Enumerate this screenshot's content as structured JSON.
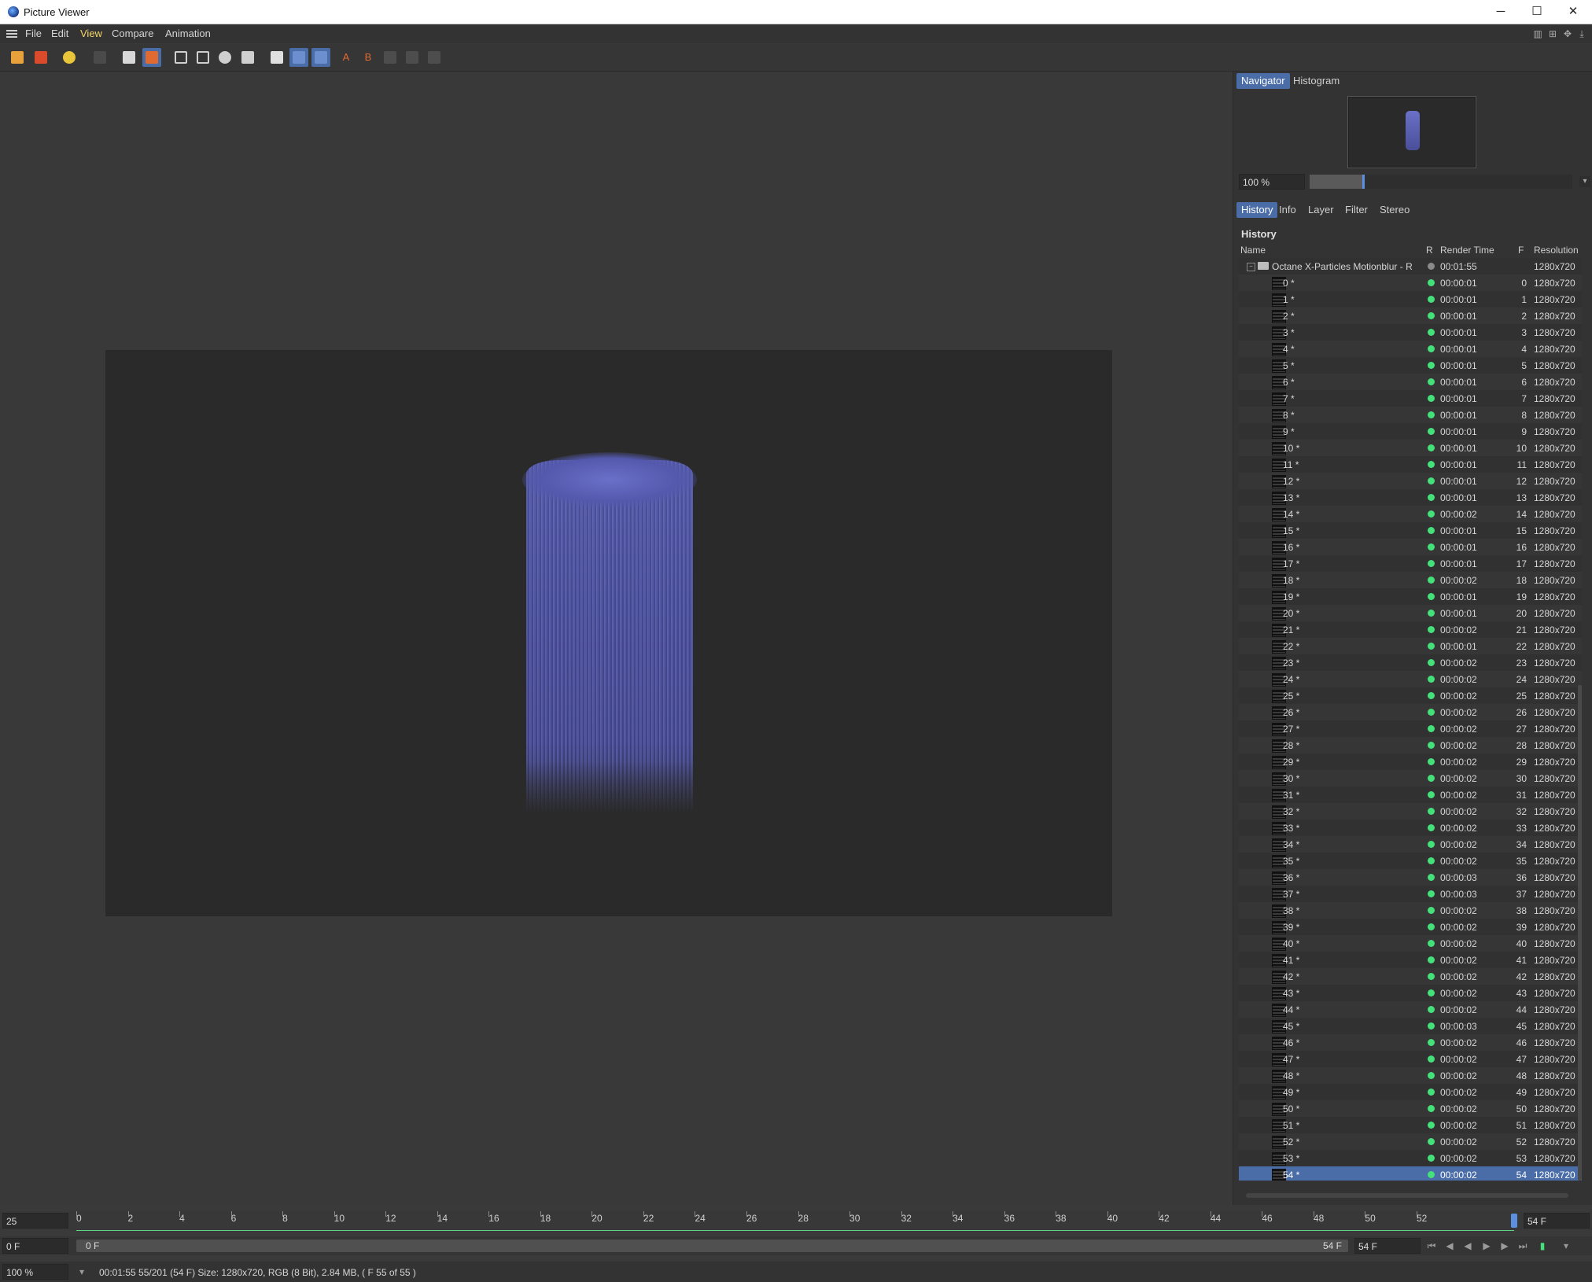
{
  "window": {
    "title": "Picture Viewer",
    "controls": [
      "─",
      "☐",
      "✕"
    ]
  },
  "menu": {
    "items": [
      "File",
      "Edit",
      "View",
      "Compare",
      "Animation"
    ],
    "active": "View"
  },
  "toolbar": {
    "icons": [
      "open-icon",
      "save-icon",
      "render-settings-icon",
      "disabled-icon",
      "export-icon",
      "layer-stack-icon",
      "view-single-icon",
      "view-double-icon",
      "view-overlay-icon",
      "view-edit-icon",
      "split-icon",
      "compare-grid-icon",
      "compare-full-icon",
      "set-a-icon",
      "set-b-icon",
      "swap-icon",
      "diff-icon",
      "wipe-icon"
    ]
  },
  "navigator": {
    "tabs": [
      "Navigator",
      "Histogram"
    ],
    "active_tab": "Navigator",
    "zoom": "100 %",
    "zoom_level_fraction": 0.2
  },
  "panel_tabs": {
    "items": [
      "History",
      "Info",
      "Layer",
      "Filter",
      "Stereo"
    ],
    "active": "History"
  },
  "history": {
    "title": "History",
    "columns": {
      "name": "Name",
      "r": "R",
      "render_time": "Render Time",
      "f": "F",
      "resolution": "Resolution"
    },
    "group": {
      "name": "Octane X-Particles Motionblur - R",
      "render_time": "00:01:55",
      "resolution": "1280x720"
    },
    "rows": [
      {
        "name": "0 *",
        "t": "00:00:01",
        "f": "0"
      },
      {
        "name": "1 *",
        "t": "00:00:01",
        "f": "1"
      },
      {
        "name": "2 *",
        "t": "00:00:01",
        "f": "2"
      },
      {
        "name": "3 *",
        "t": "00:00:01",
        "f": "3"
      },
      {
        "name": "4 *",
        "t": "00:00:01",
        "f": "4"
      },
      {
        "name": "5 *",
        "t": "00:00:01",
        "f": "5"
      },
      {
        "name": "6 *",
        "t": "00:00:01",
        "f": "6"
      },
      {
        "name": "7 *",
        "t": "00:00:01",
        "f": "7"
      },
      {
        "name": "8 *",
        "t": "00:00:01",
        "f": "8"
      },
      {
        "name": "9 *",
        "t": "00:00:01",
        "f": "9"
      },
      {
        "name": "10 *",
        "t": "00:00:01",
        "f": "10"
      },
      {
        "name": "11 *",
        "t": "00:00:01",
        "f": "11"
      },
      {
        "name": "12 *",
        "t": "00:00:01",
        "f": "12"
      },
      {
        "name": "13 *",
        "t": "00:00:01",
        "f": "13"
      },
      {
        "name": "14 *",
        "t": "00:00:02",
        "f": "14"
      },
      {
        "name": "15 *",
        "t": "00:00:01",
        "f": "15"
      },
      {
        "name": "16 *",
        "t": "00:00:01",
        "f": "16"
      },
      {
        "name": "17 *",
        "t": "00:00:01",
        "f": "17"
      },
      {
        "name": "18 *",
        "t": "00:00:02",
        "f": "18"
      },
      {
        "name": "19 *",
        "t": "00:00:01",
        "f": "19"
      },
      {
        "name": "20 *",
        "t": "00:00:01",
        "f": "20"
      },
      {
        "name": "21 *",
        "t": "00:00:02",
        "f": "21"
      },
      {
        "name": "22 *",
        "t": "00:00:01",
        "f": "22"
      },
      {
        "name": "23 *",
        "t": "00:00:02",
        "f": "23"
      },
      {
        "name": "24 *",
        "t": "00:00:02",
        "f": "24"
      },
      {
        "name": "25 *",
        "t": "00:00:02",
        "f": "25"
      },
      {
        "name": "26 *",
        "t": "00:00:02",
        "f": "26"
      },
      {
        "name": "27 *",
        "t": "00:00:02",
        "f": "27"
      },
      {
        "name": "28 *",
        "t": "00:00:02",
        "f": "28"
      },
      {
        "name": "29 *",
        "t": "00:00:02",
        "f": "29"
      },
      {
        "name": "30 *",
        "t": "00:00:02",
        "f": "30"
      },
      {
        "name": "31 *",
        "t": "00:00:02",
        "f": "31"
      },
      {
        "name": "32 *",
        "t": "00:00:02",
        "f": "32"
      },
      {
        "name": "33 *",
        "t": "00:00:02",
        "f": "33"
      },
      {
        "name": "34 *",
        "t": "00:00:02",
        "f": "34"
      },
      {
        "name": "35 *",
        "t": "00:00:02",
        "f": "35"
      },
      {
        "name": "36 *",
        "t": "00:00:03",
        "f": "36"
      },
      {
        "name": "37 *",
        "t": "00:00:03",
        "f": "37"
      },
      {
        "name": "38 *",
        "t": "00:00:02",
        "f": "38"
      },
      {
        "name": "39 *",
        "t": "00:00:02",
        "f": "39"
      },
      {
        "name": "40 *",
        "t": "00:00:02",
        "f": "40"
      },
      {
        "name": "41 *",
        "t": "00:00:02",
        "f": "41"
      },
      {
        "name": "42 *",
        "t": "00:00:02",
        "f": "42"
      },
      {
        "name": "43 *",
        "t": "00:00:02",
        "f": "43"
      },
      {
        "name": "44 *",
        "t": "00:00:02",
        "f": "44"
      },
      {
        "name": "45 *",
        "t": "00:00:03",
        "f": "45"
      },
      {
        "name": "46 *",
        "t": "00:00:02",
        "f": "46"
      },
      {
        "name": "47 *",
        "t": "00:00:02",
        "f": "47"
      },
      {
        "name": "48 *",
        "t": "00:00:02",
        "f": "48"
      },
      {
        "name": "49 *",
        "t": "00:00:02",
        "f": "49"
      },
      {
        "name": "50 *",
        "t": "00:00:02",
        "f": "50"
      },
      {
        "name": "51 *",
        "t": "00:00:02",
        "f": "51"
      },
      {
        "name": "52 *",
        "t": "00:00:02",
        "f": "52"
      },
      {
        "name": "53 *",
        "t": "00:00:02",
        "f": "53"
      },
      {
        "name": "54 *",
        "t": "00:00:02",
        "f": "54"
      }
    ],
    "row_resolution": "1280x720",
    "selected_index": 54
  },
  "timeline": {
    "fps": "25",
    "ticks": [
      "0",
      "2",
      "4",
      "6",
      "8",
      "10",
      "12",
      "14",
      "16",
      "18",
      "20",
      "22",
      "24",
      "26",
      "28",
      "30",
      "32",
      "34",
      "36",
      "38",
      "40",
      "42",
      "44",
      "46",
      "48",
      "50",
      "52"
    ],
    "end_frame": "54 F"
  },
  "transport": {
    "current_frame": "0 F",
    "range_start": "0 F",
    "range_end": "54 F",
    "max_frame": "54 F"
  },
  "status": {
    "zoom": "100 %",
    "text": "00:01:55 55/201 (54 F)   Size: 1280x720, RGB (8 Bit), 2.84 MB,  ( F 55 of 55 )"
  },
  "colors": {
    "accent": "#4a6da8",
    "status_ok": "#44e07a",
    "particles": "#5a5fb0"
  }
}
